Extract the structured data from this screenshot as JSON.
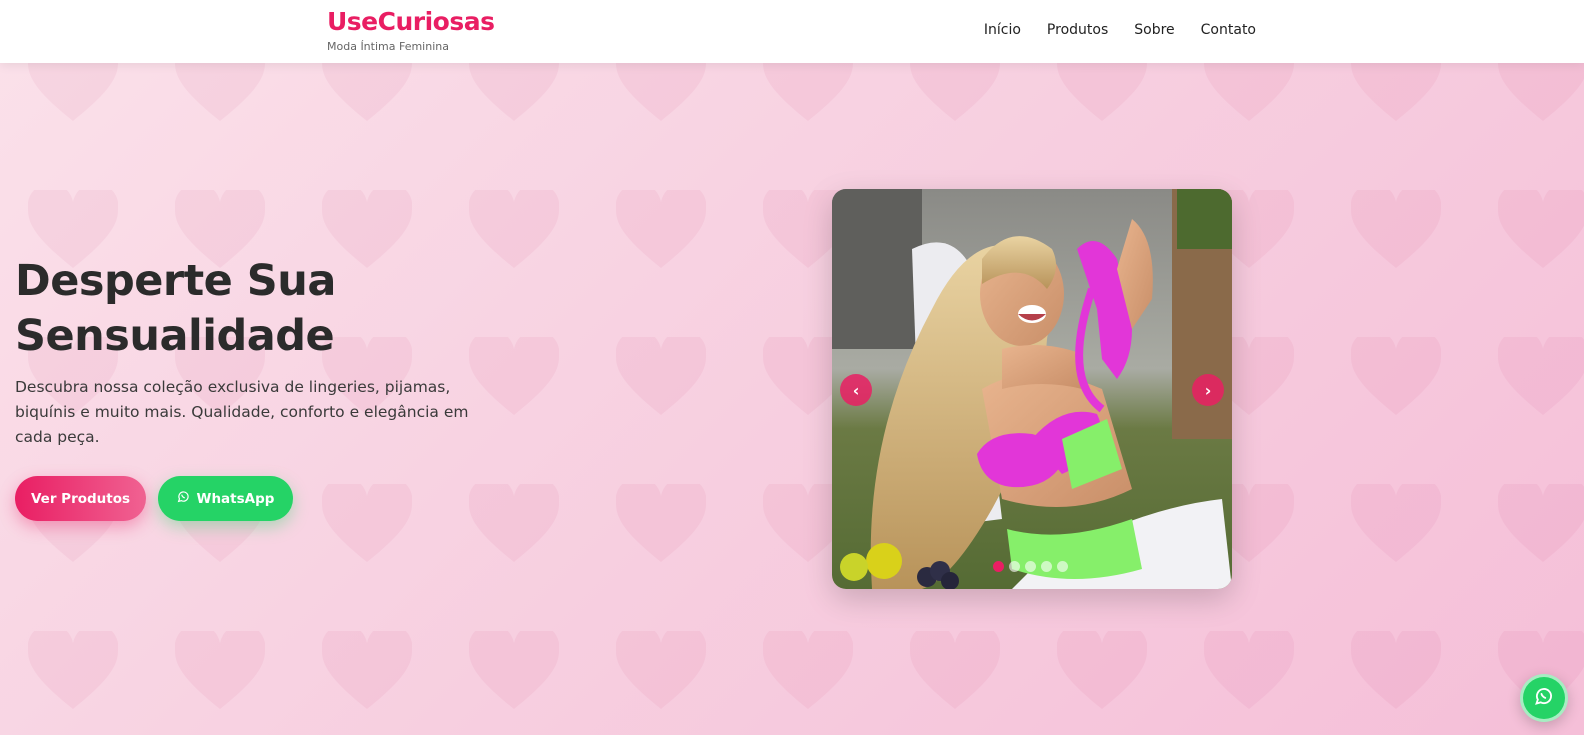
{
  "header": {
    "brand_name": "UseCuriosas",
    "brand_tagline": "Moda Íntima Feminina",
    "nav": [
      {
        "label": "Início"
      },
      {
        "label": "Produtos"
      },
      {
        "label": "Sobre"
      },
      {
        "label": "Contato"
      }
    ]
  },
  "hero": {
    "title_line1": "Desperte Sua",
    "title_line2": "Sensualidade",
    "description": "Descubra nossa coleção exclusiva de lingeries, pijamas, biquínis e muito mais. Qualidade, conforto e elegância em cada peça.",
    "primary_button": "Ver Produtos",
    "whatsapp_button": "WhatsApp"
  },
  "carousel": {
    "prev_icon": "chevron-left-icon",
    "next_icon": "chevron-right-icon",
    "slide_count": 5,
    "active_slide": 1
  },
  "colors": {
    "brand": "#e91e63",
    "whatsapp": "#25d366",
    "background": "#f7cfe0"
  }
}
